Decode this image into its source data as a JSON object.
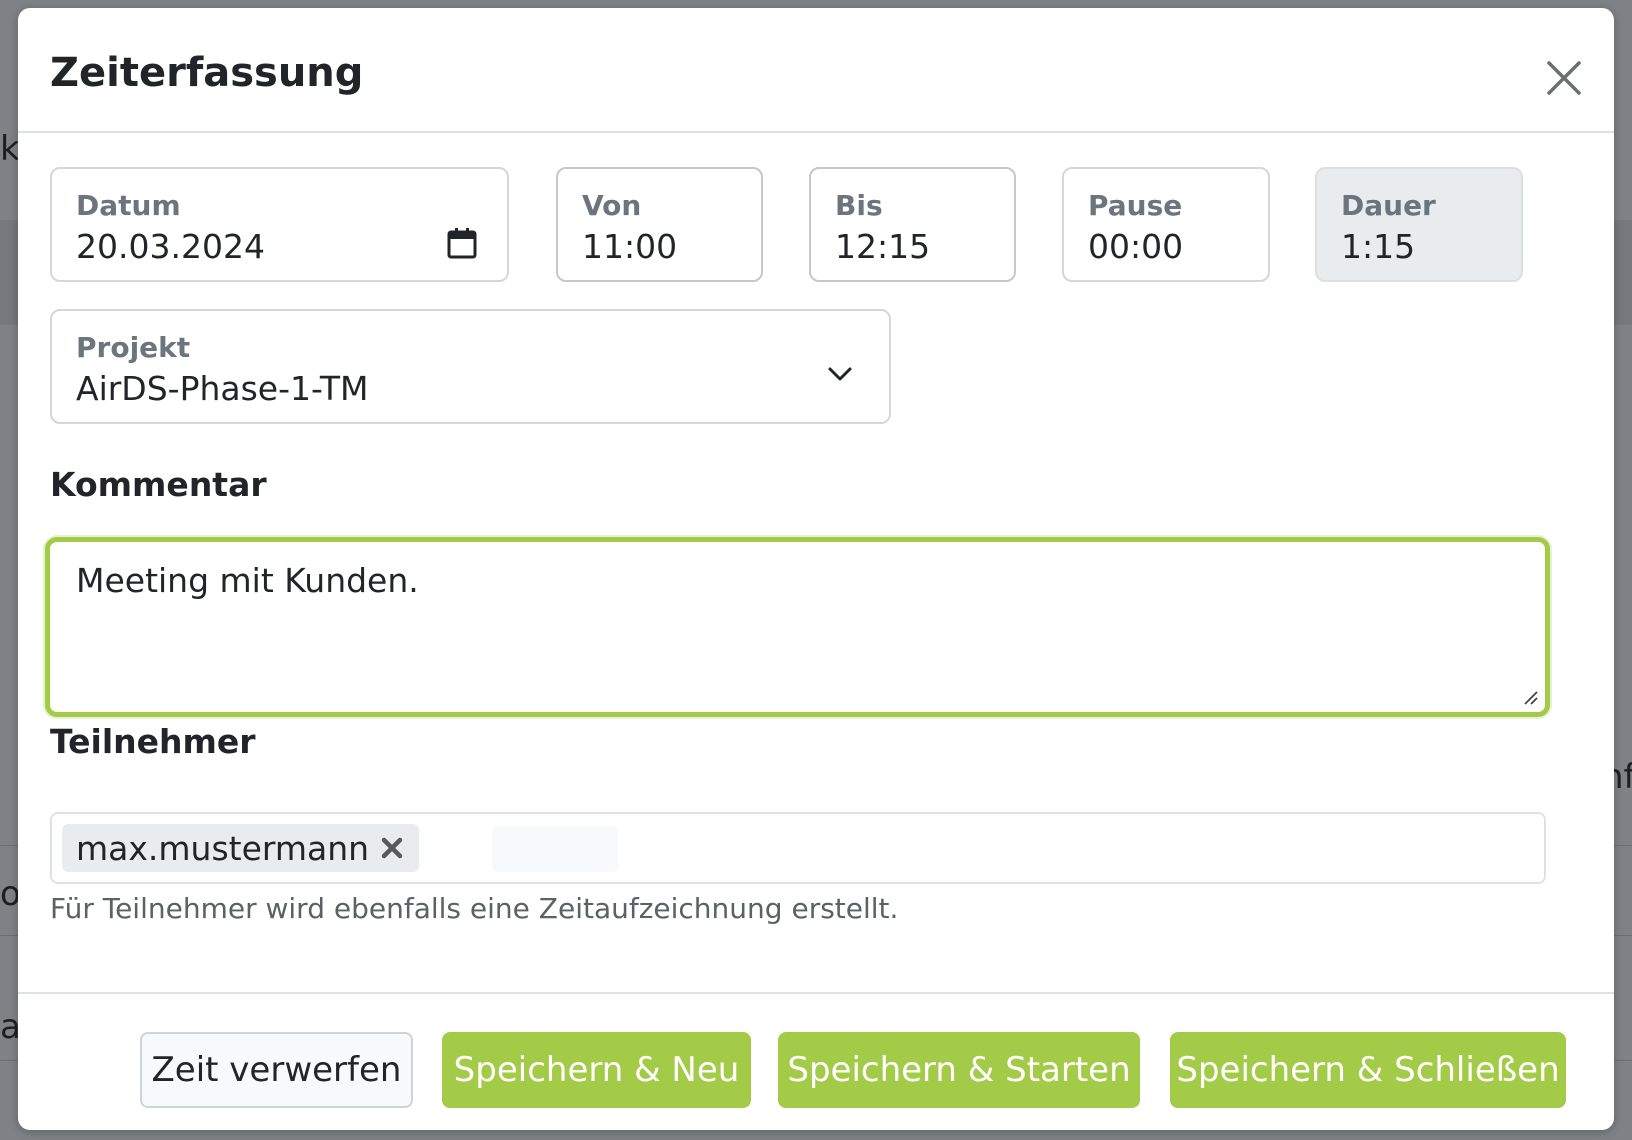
{
  "background": {
    "fragments": [
      "k",
      "nf",
      "o",
      "at"
    ]
  },
  "modal": {
    "title": "Zeiterfassung",
    "close_icon": "close-icon",
    "fields": {
      "datum": {
        "label": "Datum",
        "value": "20.03.2024",
        "icon": "calendar-icon"
      },
      "von": {
        "label": "Von",
        "value": "11:00"
      },
      "bis": {
        "label": "Bis",
        "value": "12:15"
      },
      "pause": {
        "label": "Pause",
        "value": "00:00"
      },
      "dauer": {
        "label": "Dauer",
        "value": "1:15"
      },
      "projekt": {
        "label": "Projekt",
        "value": "AirDS-Phase-1-TM",
        "icon": "chevron-down-icon"
      }
    },
    "kommentar": {
      "label": "Kommentar",
      "value": "Meeting mit Kunden."
    },
    "teilnehmer": {
      "label": "Teilnehmer",
      "tags": [
        "max.mustermann"
      ],
      "hint": "Für Teilnehmer wird ebenfalls eine Zeitaufzeichnung erstellt."
    },
    "buttons": {
      "discard": "Zeit verwerfen",
      "save_new": "Speichern & Neu",
      "save_start": "Speichern & Starten",
      "save_close": "Speichern & Schließen"
    },
    "colors": {
      "accent": "#a3cb48",
      "title_text": "#212529",
      "label_text": "#6c757d"
    }
  }
}
